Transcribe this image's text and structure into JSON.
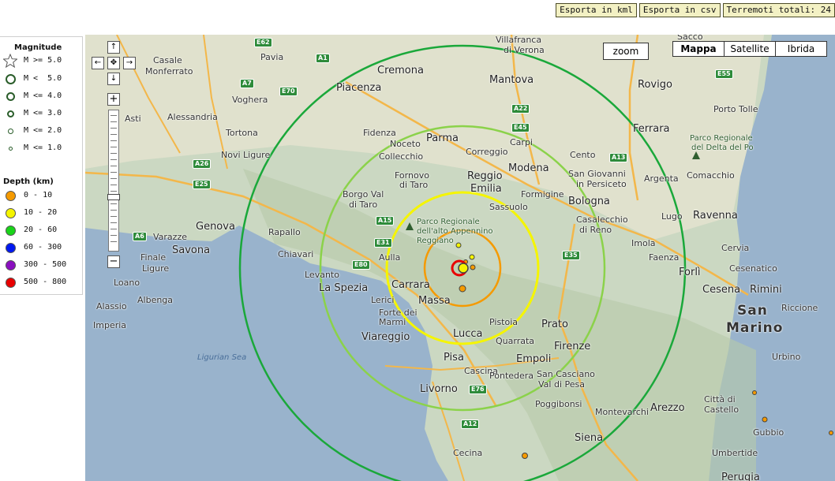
{
  "topbar": {
    "export_kml": "Esporta in kml",
    "export_csv": "Esporta in csv",
    "total": "Terremoti totali: 24"
  },
  "legend": {
    "magnitude_title": "Magnitude",
    "magnitude": [
      "M >= 5.0",
      "M <  5.0",
      "M <= 4.0",
      "M <= 3.0",
      "M <= 2.0",
      "M <= 1.0"
    ],
    "depth_title": "Depth (km)",
    "depth": [
      {
        "label": "0 - 10",
        "color": "#f59a00"
      },
      {
        "label": "10 - 20",
        "color": "#f5f500"
      },
      {
        "label": "20 - 60",
        "color": "#19d419"
      },
      {
        "label": "60 - 300",
        "color": "#0018f0"
      },
      {
        "label": "300 - 500",
        "color": "#8a0fbf"
      },
      {
        "label": "500 - 800",
        "color": "#e80000"
      }
    ]
  },
  "map_controls": {
    "zoom": "zoom",
    "map_types": [
      "Mappa",
      "Satellite",
      "Ibrida"
    ],
    "active_type": "Mappa"
  },
  "places": {
    "pavia": "Pavia",
    "casale": "Casale",
    "monferrato": "Monferrato",
    "asti": "Asti",
    "alessandria": "Alessandria",
    "voghera": "Voghera",
    "tortona": "Tortona",
    "novi": "Novi Ligure",
    "piacenza": "Piacenza",
    "cremona": "Cremona",
    "villafranca": "Villafranca",
    "diverona": "di Verona",
    "mantova": "Mantova",
    "rovigo": "Rovigo",
    "sacco": "Sacco",
    "portotolle": "Porto Tolle",
    "ferrara": "Ferrara",
    "fidenza": "Fidenza",
    "parma": "Parma",
    "noceto": "Noceto",
    "correggio": "Correggio",
    "carpi": "Carpi",
    "collecchio": "Collecchio",
    "cento": "Cento",
    "fornovo": "Fornovo",
    "ditaro": "di Taro",
    "reggio": "Reggio",
    "emilia": "Emilia",
    "modena": "Modena",
    "sangiovanni": "San Giovanni",
    "inpersiceto": "in Persiceto",
    "argenta": "Argenta",
    "comacchio": "Comacchio",
    "parcodelta1": "Parco Regionale",
    "parcodelta2": "del Delta del Po",
    "genova": "Genova",
    "borgoval": "Borgo Val",
    "ditaro2": "di Taro",
    "formigine": "Formigine",
    "sassuolo": "Sassuolo",
    "bologna": "Bologna",
    "lugo": "Lugo",
    "ravenna": "Ravenna",
    "savona": "Savona",
    "varazze": "Varazze",
    "rapallo": "Rapallo",
    "chiavari": "Chiavari",
    "finale": "Finale",
    "ligure": "Ligure",
    "loano": "Loano",
    "albenga": "Albenga",
    "alassio": "Alassio",
    "imperia": "Imperia",
    "casalecchio": "Casalecchio",
    "direno": "di Reno",
    "imola": "Imola",
    "faenza": "Faenza",
    "forli": "Forlì",
    "cervia": "Cervia",
    "cesenatico": "Cesenatico",
    "cesena": "Cesena",
    "rimini": "Rimini",
    "riccione": "Riccione",
    "sanmarino1": "San",
    "sanmarino2": "Marino",
    "levanto": "Levanto",
    "laspezia": "La Spezia",
    "aulla": "Aulla",
    "carrara": "Carrara",
    "lerici": "Lerici",
    "massa": "Massa",
    "forte": "Forte dei",
    "marmi": "Marmi",
    "viareggio": "Viareggio",
    "lucca": "Lucca",
    "pistoia": "Pistoia",
    "prato": "Prato",
    "quarrata": "Quarrata",
    "firenze": "Firenze",
    "pisa": "Pisa",
    "cascina": "Cascina",
    "empoli": "Empoli",
    "pontedera": "Pontedera",
    "sancasciano": "San Casciano",
    "valdipesa": "Val di Pesa",
    "poggibonsi": "Poggibonsi",
    "livorno": "Livorno",
    "montevarchi": "Montevarchi",
    "arezzo": "Arezzo",
    "siena": "Siena",
    "cecina": "Cecina",
    "urbino": "Urbino",
    "citta": "Città di",
    "castello": "Castello",
    "gubbio": "Gubbio",
    "umbertide": "Umbertide",
    "perugia": "Perugia",
    "parcoapp1": "Parco Regionale",
    "parcoapp2": "dell'alto Appennino",
    "parcoapp3": "Reggiano",
    "ligurian": "Ligurian Sea"
  },
  "roads": [
    "E62",
    "A1",
    "E70",
    "A7",
    "E25",
    "A26",
    "E45",
    "A22",
    "A13",
    "E55",
    "A15",
    "E31",
    "A12",
    "A6",
    "E80",
    "E35",
    "E76"
  ]
}
